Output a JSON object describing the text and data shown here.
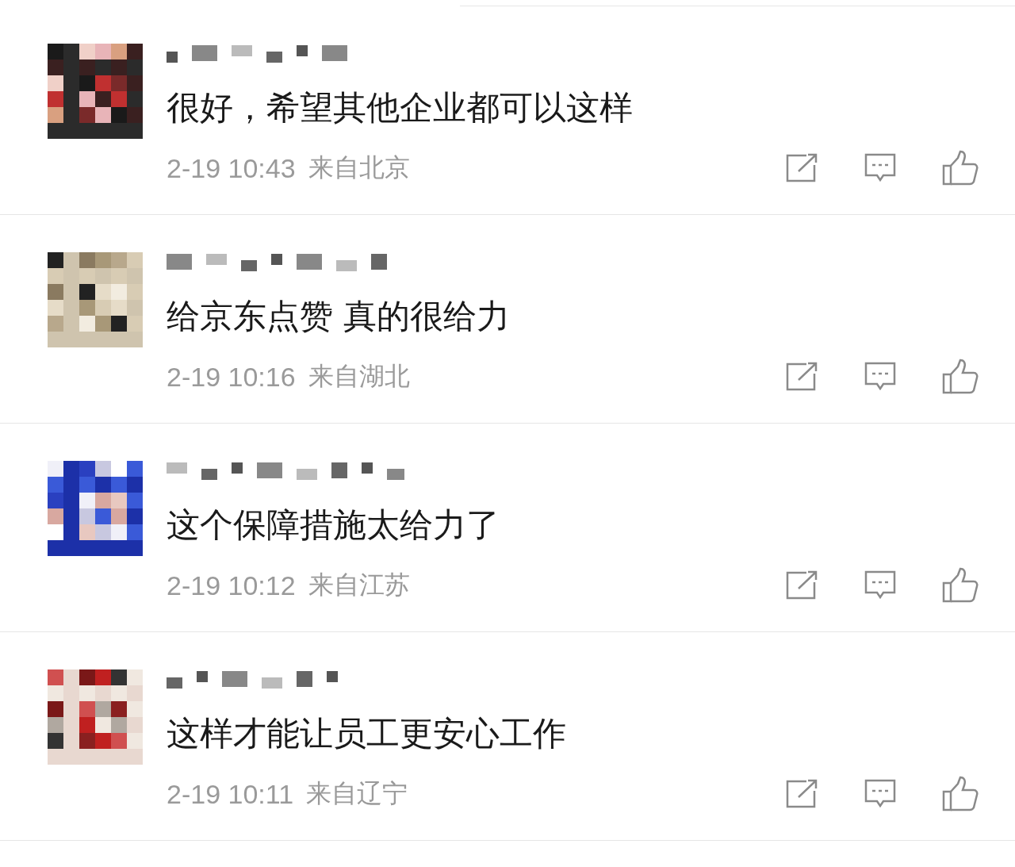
{
  "comments": [
    {
      "text": "很好，希望其他企业都可以这样",
      "time": "2-19 10:43",
      "location": "来自北京"
    },
    {
      "text": "给京东点赞 真的很给力",
      "time": "2-19 10:16",
      "location": "来自湖北"
    },
    {
      "text": "这个保障措施太给力了",
      "time": "2-19 10:12",
      "location": "来自江苏"
    },
    {
      "text": "这样才能让员工更安心工作",
      "time": "2-19 10:11",
      "location": "来自辽宁"
    }
  ]
}
